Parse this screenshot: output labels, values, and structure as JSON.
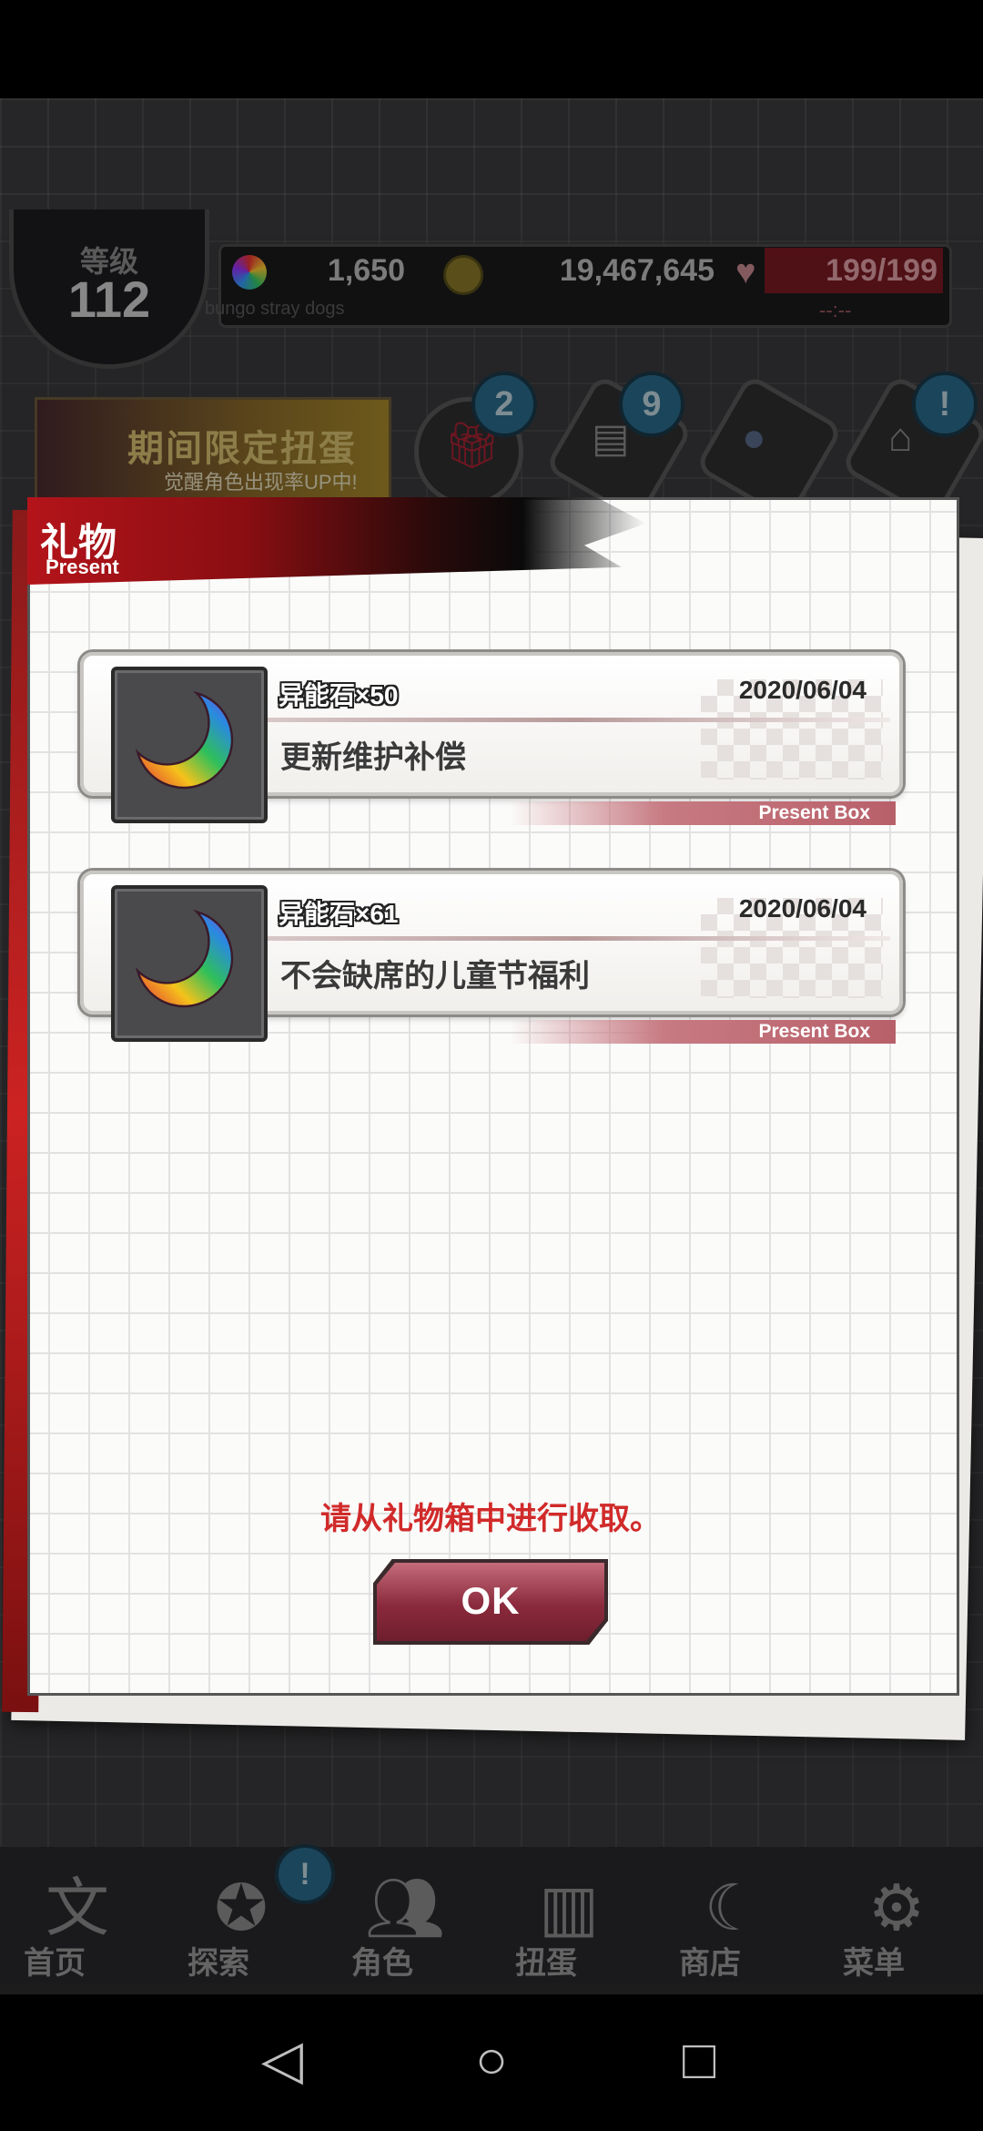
{
  "hud": {
    "level_label": "等级",
    "level_value": "112",
    "gems": "1,650",
    "coins": "19,467,645",
    "stamina": "199/199",
    "stamina_timer": "--:--",
    "subtitle": "bungo stray dogs"
  },
  "banner": {
    "title": "期间限定扭蛋",
    "subtitle": "觉醒角色出现率UP中!"
  },
  "shortcuts": [
    {
      "name": "gift",
      "badge": "2"
    },
    {
      "name": "news",
      "badge": "9"
    },
    {
      "name": "gacha",
      "badge": ""
    },
    {
      "name": "building",
      "badge": "!"
    }
  ],
  "nav": {
    "items": [
      {
        "label": "首页",
        "icon": "wengao-logo-icon"
      },
      {
        "label": "探索",
        "icon": "lion-icon"
      },
      {
        "label": "角色",
        "icon": "people-icon"
      },
      {
        "label": "扭蛋",
        "icon": "book-icon"
      },
      {
        "label": "商店",
        "icon": "moon-gem-icon"
      },
      {
        "label": "菜单",
        "icon": "gear-icon"
      }
    ],
    "explore_badge": "!"
  },
  "modal": {
    "title": "礼物",
    "title_en": "Present",
    "presents": [
      {
        "item": "异能石×50",
        "date": "2020/06/04",
        "description": "更新维护补偿",
        "tag": "Present Box"
      },
      {
        "item": "异能石×61",
        "date": "2020/06/04",
        "description": "不会缺席的儿童节福利",
        "tag": "Present Box"
      }
    ],
    "notice": "请从礼物箱中进行收取。",
    "ok_label": "OK"
  },
  "colors": {
    "accent_red": "#b3141a",
    "notice_red": "#d12a2a",
    "ok_button": "#8a2a3c"
  }
}
